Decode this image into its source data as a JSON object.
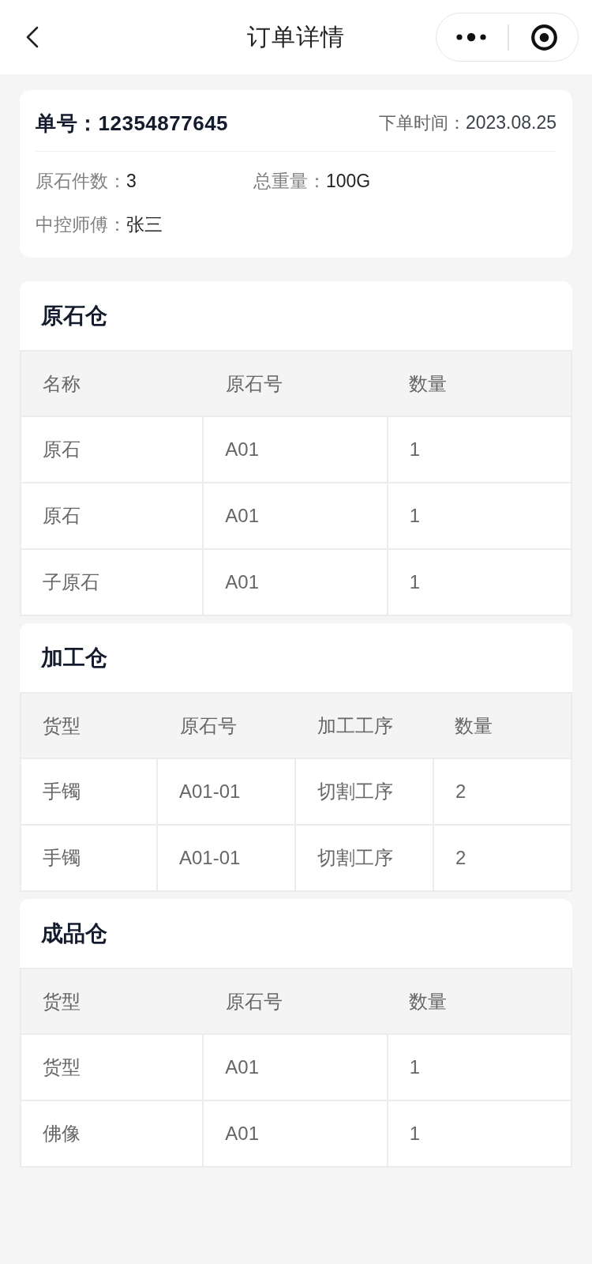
{
  "nav_bar": {
    "title": "订单详情"
  },
  "order_card": {
    "order_number": "单号：12354877645",
    "order_time": {
      "label": "下单时间：",
      "value": "2023.08.25"
    },
    "fields": [
      {
        "label": "原石件数：",
        "value": "3"
      },
      {
        "label": "总重量：",
        "value": "100G"
      },
      {
        "label": "中控师傅：",
        "value": "张三"
      }
    ]
  },
  "sections": [
    {
      "title": "原石仓",
      "table": {
        "columns": [
          "名称",
          "原石号",
          "数量"
        ],
        "rows": [
          [
            "原石",
            "A01",
            "1"
          ],
          [
            "原石",
            "A01",
            "1"
          ],
          [
            "子原石",
            "A01",
            "1"
          ]
        ]
      }
    },
    {
      "title": "加工仓",
      "table": {
        "columns": [
          "货型",
          "原石号",
          "加工工序",
          "数量"
        ],
        "rows": [
          [
            "手镯",
            "A01-01",
            "切割工序",
            "2"
          ],
          [
            "手镯",
            "A01-01",
            "切割工序",
            "2"
          ]
        ]
      }
    },
    {
      "title": "成品仓",
      "table": {
        "columns": [
          "货型",
          "原石号",
          "数量"
        ],
        "rows": [
          [
            "货型",
            "A01",
            "1"
          ],
          [
            "佛像",
            "A01",
            "1"
          ]
        ]
      }
    }
  ]
}
